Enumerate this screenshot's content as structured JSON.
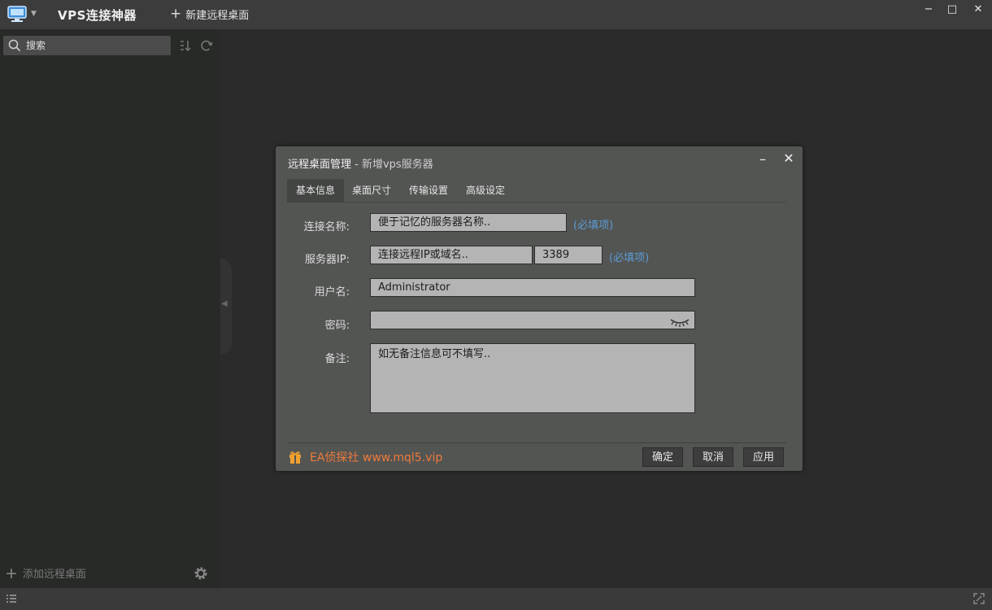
{
  "app": {
    "title": "VPS连接神器",
    "new_remote_label": "新建远程桌面",
    "window_controls": {
      "minimize": "−",
      "maximize": "□",
      "close": "✕"
    }
  },
  "sidebar": {
    "search_placeholder": "搜索",
    "add_remote_label": "添加远程桌面"
  },
  "dialog": {
    "title": "远程桌面管理",
    "title_sep": " - ",
    "subtitle": "新增vps服务器",
    "tabs": [
      "基本信息",
      "桌面尺寸",
      "传输设置",
      "高级设定"
    ],
    "active_tab": "基本信息",
    "form": {
      "name_label": "连接名称:",
      "name_placeholder": "便于记忆的服务器名称..",
      "required_text": "(必填项)",
      "server_label": "服务器IP:",
      "server_placeholder": "连接远程IP或域名..",
      "port_value": "3389",
      "user_label": "用户名:",
      "user_value": "Administrator",
      "password_label": "密码:",
      "password_value": "",
      "note_label": "备注:",
      "note_placeholder": "如无备注信息可不填写.."
    },
    "footer": {
      "brand_text": "EA侦探社 www.mql5.vip",
      "ok_label": "确定",
      "cancel_label": "取消",
      "apply_label": "应用"
    }
  },
  "colors": {
    "accent_link": "#5b9bd5",
    "brand_orange": "#f07a3a"
  },
  "icons": [
    "monitor-logo-icon",
    "plus-icon",
    "search-icon",
    "sort-icon",
    "refresh-icon",
    "gear-icon",
    "list-icon",
    "expand-icon",
    "eye-closed-icon",
    "gift-icon"
  ]
}
